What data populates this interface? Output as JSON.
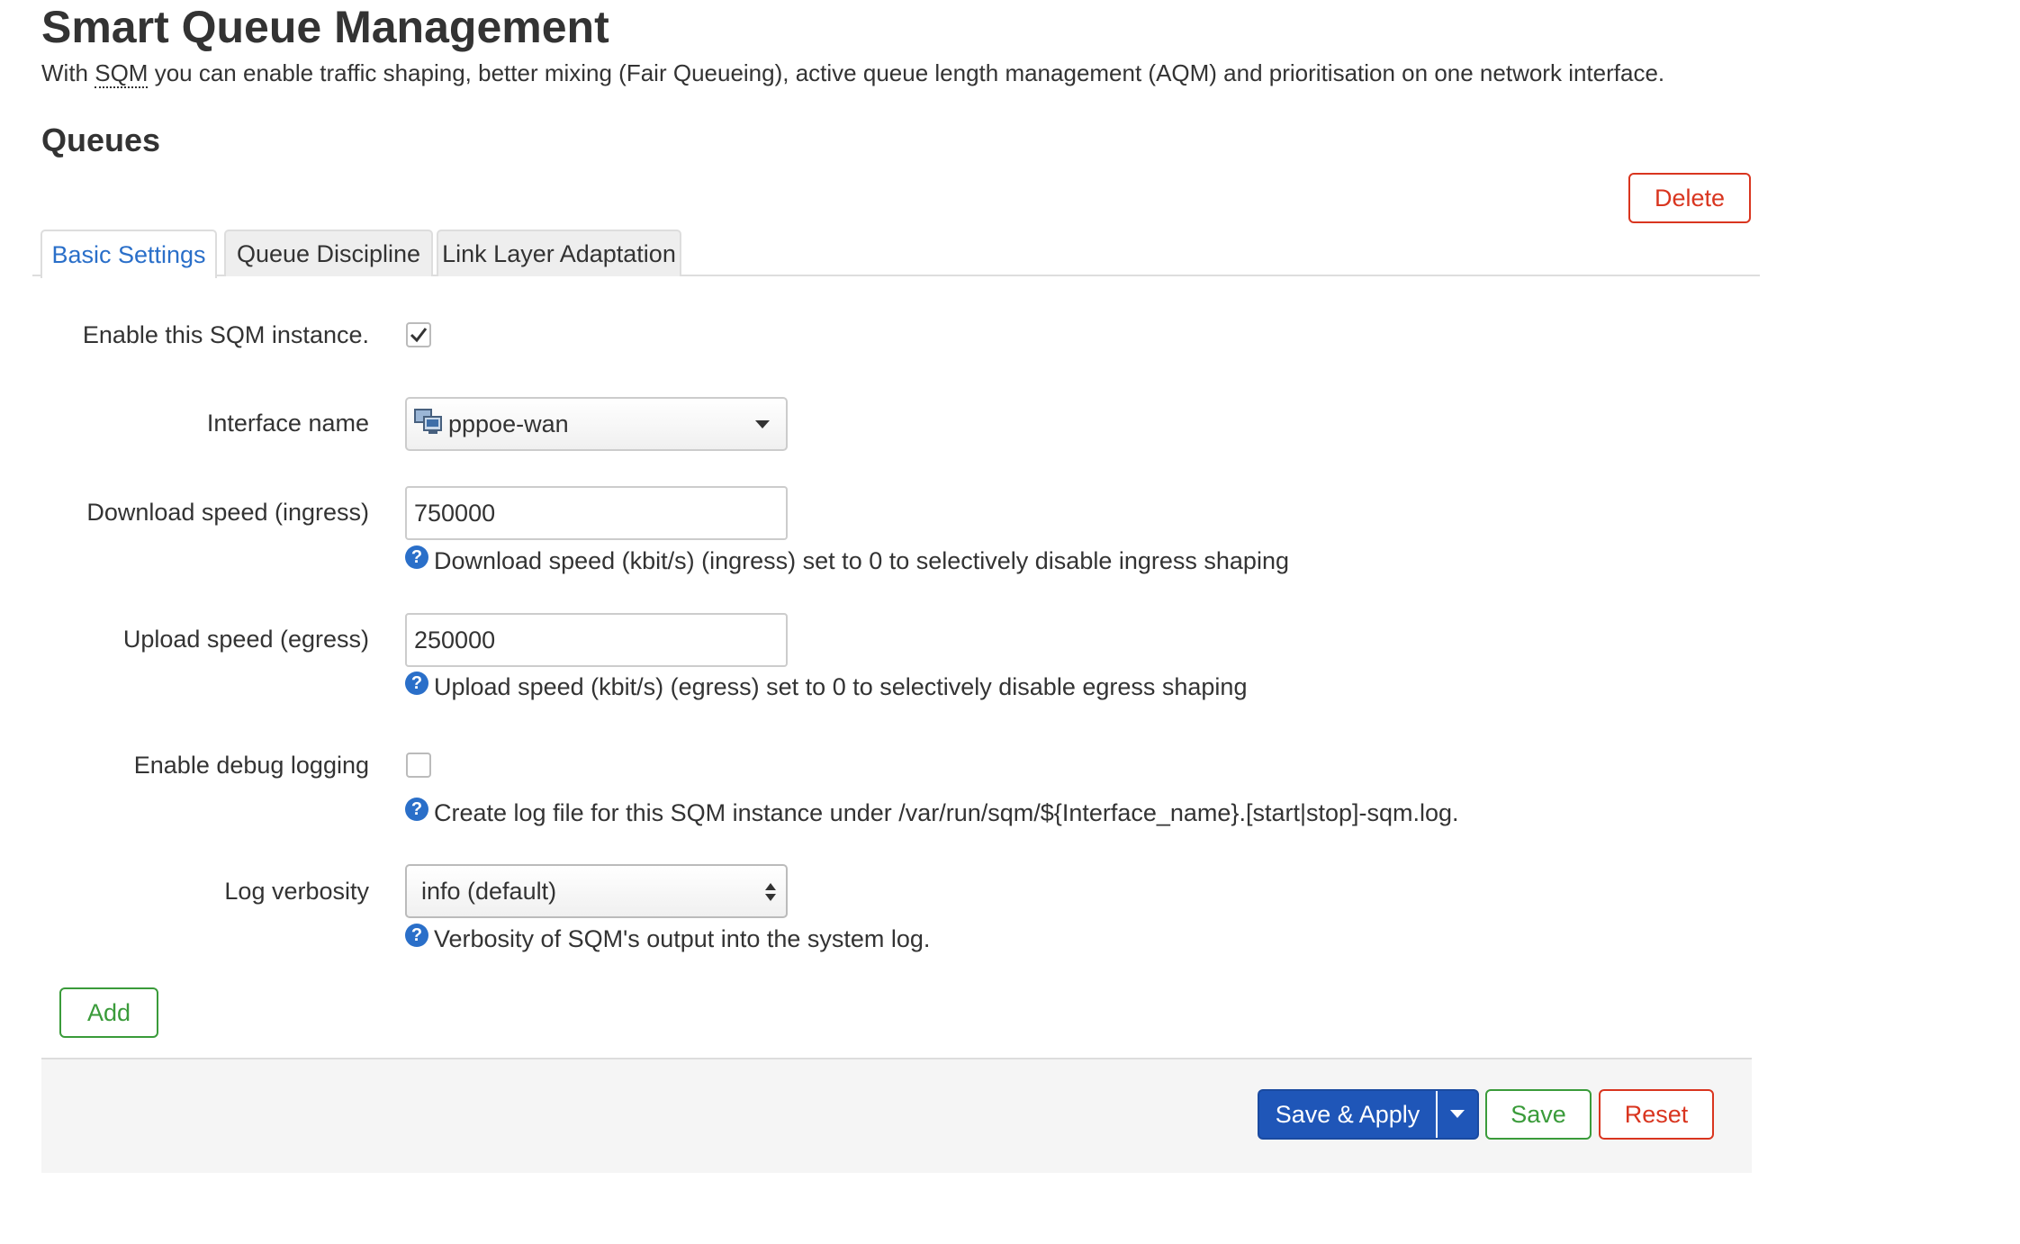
{
  "header": {
    "title": "Smart Queue Management",
    "description_prefix": "With ",
    "description_abbr": "SQM",
    "description_suffix": " you can enable traffic shaping, better mixing (Fair Queueing), active queue length management (AQM) and prioritisation on one network interface."
  },
  "section": {
    "title": "Queues",
    "delete_label": "Delete",
    "add_label": "Add"
  },
  "tabs": [
    {
      "label": "Basic Settings",
      "active": true
    },
    {
      "label": "Queue Discipline",
      "active": false
    },
    {
      "label": "Link Layer Adaptation",
      "active": false
    }
  ],
  "form": {
    "enable": {
      "label": "Enable this SQM instance.",
      "checked": true
    },
    "interface": {
      "label": "Interface name",
      "value": "pppoe-wan",
      "icon": "network-interface-icon"
    },
    "download": {
      "label": "Download speed (ingress)",
      "value": "750000",
      "help": "Download speed (kbit/s) (ingress) set to 0 to selectively disable ingress shaping"
    },
    "upload": {
      "label": "Upload speed (egress)",
      "value": "250000",
      "help": "Upload speed (kbit/s) (egress) set to 0 to selectively disable egress shaping"
    },
    "debug": {
      "label": "Enable debug logging",
      "checked": false,
      "help": "Create log file for this SQM instance under /var/run/sqm/${Interface_name}.[start|stop]-sqm.log."
    },
    "verbosity": {
      "label": "Log verbosity",
      "value": "info (default)",
      "help": "Verbosity of SQM's output into the system log."
    },
    "help_icon": "?"
  },
  "footer": {
    "save_apply_label": "Save & Apply",
    "save_label": "Save",
    "reset_label": "Reset"
  },
  "colors": {
    "accent_blue": "#2a6fc9",
    "primary_button": "#1f56b8",
    "positive_green": "#3a9b3a",
    "negative_red": "#d9351f"
  }
}
